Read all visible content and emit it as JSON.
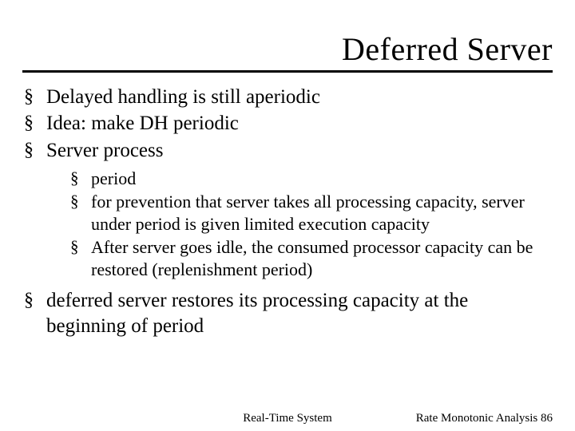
{
  "title": "Deferred Server",
  "bullets": {
    "b0": "Delayed handling is still aperiodic",
    "b1": "Idea: make DH periodic",
    "b2": "Server process",
    "b2_sub": {
      "s0": "period",
      "s1": "for prevention that server takes all processing capacity, server under period is given limited execution capacity",
      "s2": "After server goes idle, the consumed processor capacity can be restored (replenishment period)"
    },
    "b3": "deferred server restores its processing capacity at the beginning of period"
  },
  "footer": {
    "center": "Real-Time System",
    "right": "Rate Monotonic Analysis 86"
  }
}
